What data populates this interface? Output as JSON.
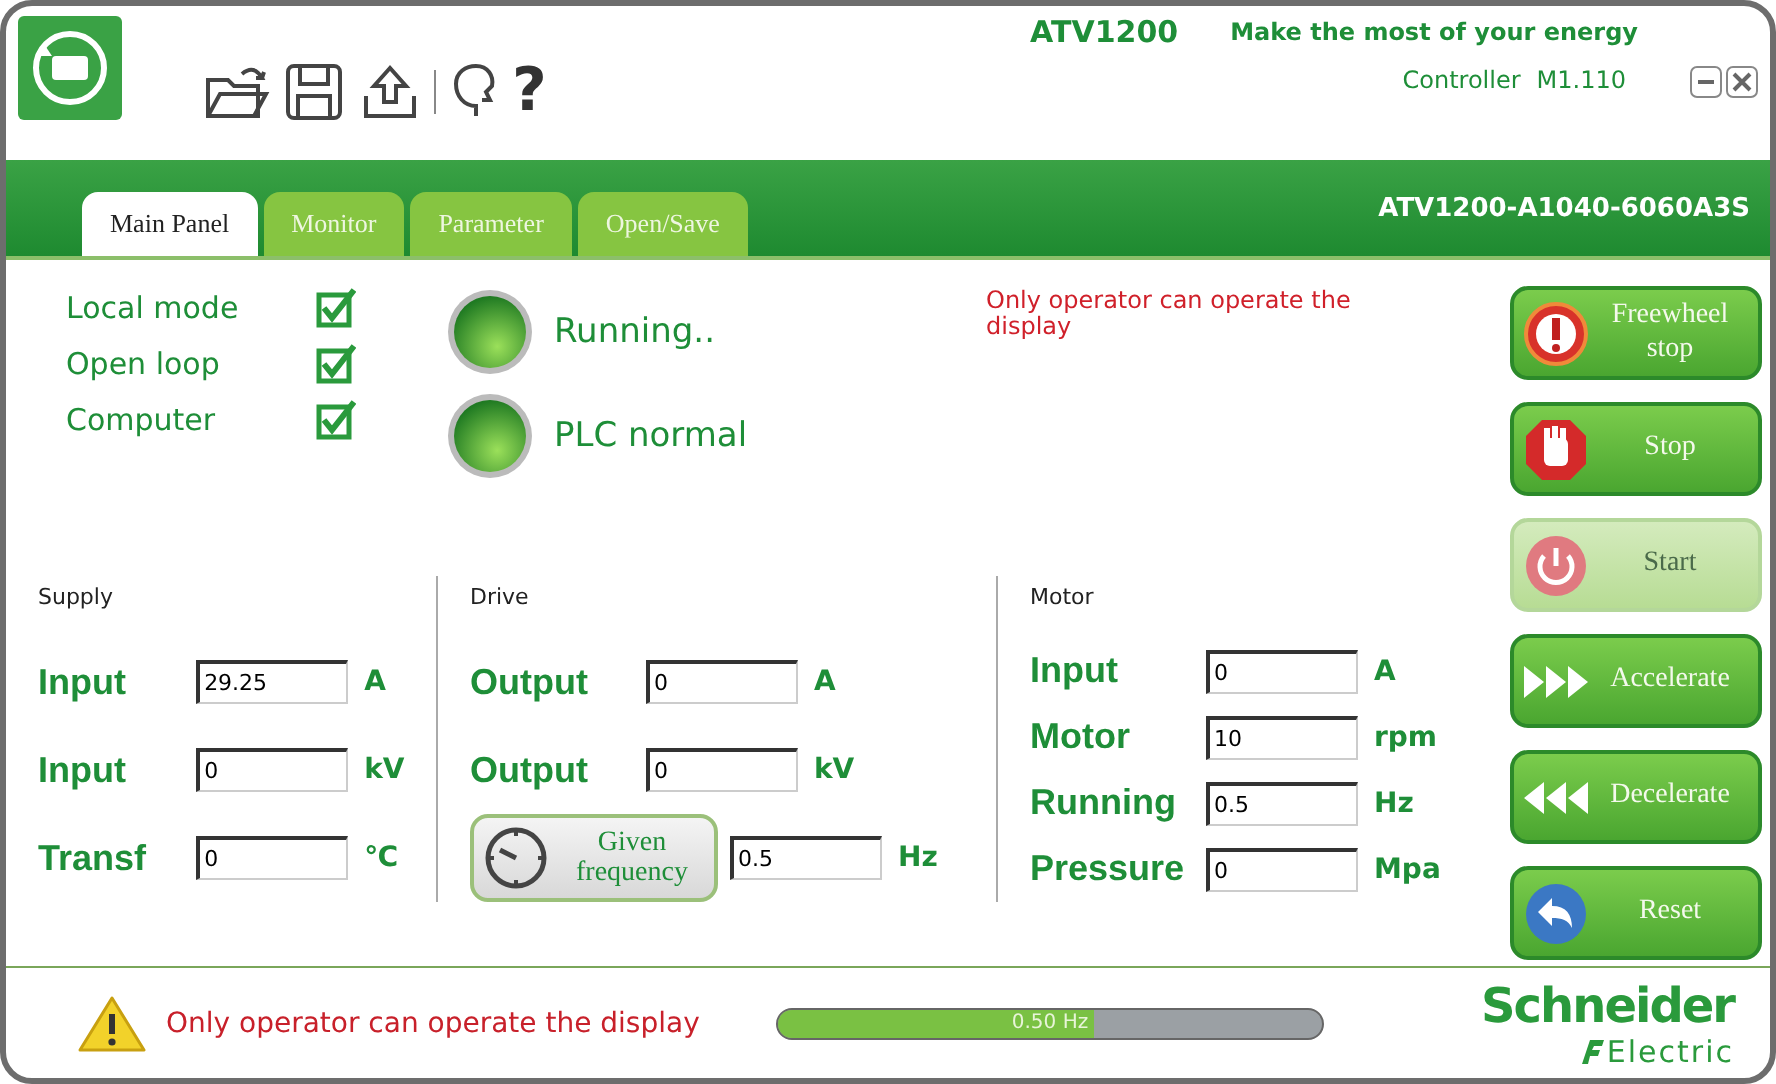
{
  "header": {
    "product": "ATV1200",
    "slogan": "Make the most of your energy",
    "controller_label": "Controller",
    "controller_version": "M1.110",
    "help_glyph": "?"
  },
  "tabs": [
    {
      "label": "Main Panel",
      "selected": true
    },
    {
      "label": "Monitor",
      "selected": false
    },
    {
      "label": "Parameter",
      "selected": false
    },
    {
      "label": "Open/Save",
      "selected": false
    }
  ],
  "model": "ATV1200-A1040-6060A3S",
  "modes": [
    {
      "label": "Local mode",
      "checked": true
    },
    {
      "label": "Open loop",
      "checked": true
    },
    {
      "label": "Computer",
      "checked": true
    }
  ],
  "indicators": [
    {
      "label": "Running..",
      "on": true
    },
    {
      "label": "PLC normal",
      "on": true
    }
  ],
  "notice": "Only operator can operate the display",
  "groups": [
    {
      "title": "Supply",
      "rows": [
        {
          "kind": "field",
          "label": "Input",
          "value": "29.25",
          "unit": "A"
        },
        {
          "kind": "field",
          "label": "Input",
          "value": "0",
          "unit": "kV"
        },
        {
          "kind": "field",
          "label": "Transf",
          "value": "0",
          "unit": "℃"
        }
      ]
    },
    {
      "title": "Drive",
      "rows": [
        {
          "kind": "field",
          "label": "Output",
          "value": "0",
          "unit": "A"
        },
        {
          "kind": "field",
          "label": "Output",
          "value": "0",
          "unit": "kV"
        },
        {
          "kind": "button",
          "label": "Given frequency",
          "value": "0.5",
          "unit": "Hz"
        }
      ]
    },
    {
      "title": "Motor",
      "rows": [
        {
          "kind": "field",
          "label": "Input",
          "value": "0",
          "unit": "A"
        },
        {
          "kind": "field",
          "label": "Motor",
          "value": "10",
          "unit": "rpm"
        },
        {
          "kind": "field",
          "label": "Running",
          "value": "0.5",
          "unit": "Hz"
        },
        {
          "kind": "field",
          "label": "Pressure",
          "value": "0",
          "unit": "Mpa"
        }
      ]
    }
  ],
  "buttons": [
    {
      "kind": "alert",
      "label": "Freewheel stop",
      "disabled": false
    },
    {
      "kind": "stop",
      "label": "Stop",
      "disabled": false
    },
    {
      "kind": "power",
      "label": "Start",
      "disabled": true
    },
    {
      "kind": "forward",
      "label": "Accelerate",
      "disabled": false
    },
    {
      "kind": "back",
      "label": "Decelerate",
      "disabled": false
    },
    {
      "kind": "undo",
      "label": "Reset",
      "disabled": false
    }
  ],
  "status_bar": {
    "message": "Only operator can operate the display",
    "progress": {
      "level": 0.58,
      "reading": "0.50 Hz"
    }
  },
  "logo": {
    "name": "Schneider",
    "sub": "Electric"
  }
}
